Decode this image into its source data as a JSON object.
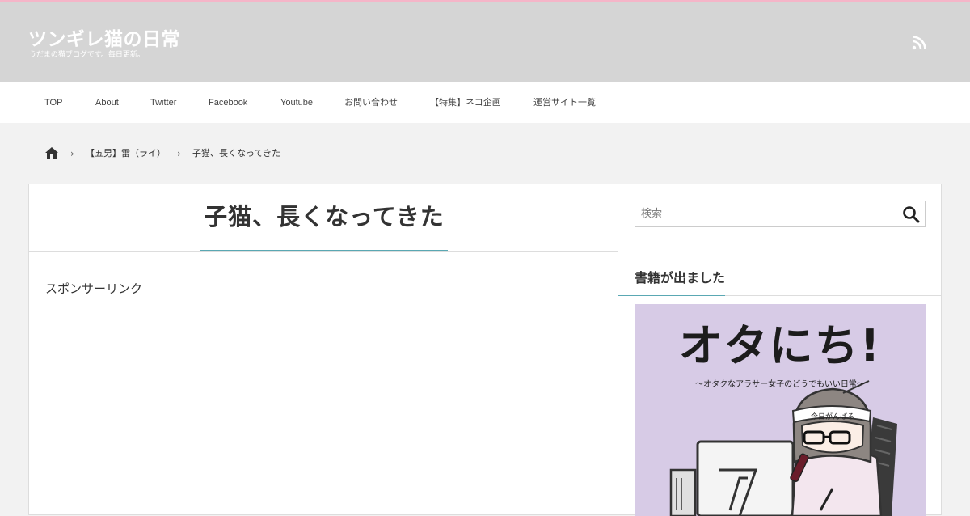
{
  "site": {
    "title": "ツンギレ猫の日常",
    "description": "うだまの猫ブログです。毎日更新。",
    "rss_icon": "rss-icon"
  },
  "nav": {
    "items": [
      {
        "label": "TOP"
      },
      {
        "label": "About"
      },
      {
        "label": "Twitter"
      },
      {
        "label": "Facebook"
      },
      {
        "label": "Youtube"
      },
      {
        "label": "お問い合わせ"
      },
      {
        "label": "【特集】ネコ企画"
      },
      {
        "label": "運営サイト一覧"
      }
    ]
  },
  "breadcrumb": {
    "home_icon": "home-icon",
    "items": [
      {
        "label": "【五男】雷（ライ）"
      },
      {
        "label": "子猫、長くなってきた"
      }
    ]
  },
  "post": {
    "title": "子猫、長くなってきた",
    "sponsor_label": "スポンサーリンク"
  },
  "sidebar": {
    "search": {
      "placeholder": "検索",
      "value": "",
      "icon": "search-icon"
    },
    "widget_title": "書籍が出ました",
    "book": {
      "title": "オタにち!",
      "subtitle": "〜オタクなアラサー女子のどうでもいい日常〜",
      "headband_text": "今日がんばる"
    }
  },
  "colors": {
    "header_bg": "#d5d5d5",
    "top_line": "#f5b5c8",
    "accent_underline": "#5aa8b3",
    "page_bg": "#f2f2f2",
    "book_bg": "#d7cbe6"
  }
}
